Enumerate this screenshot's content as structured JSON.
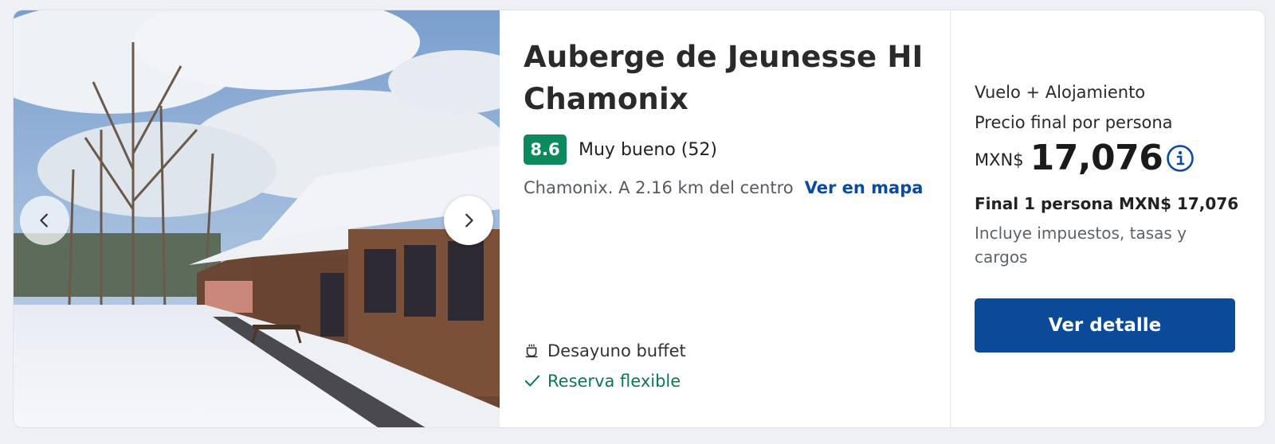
{
  "hotel": {
    "name": "Auberge de Jeunesse HI Chamonix",
    "score": "8.6",
    "rating_label": "Muy bueno (52)",
    "location": "Chamonix. A 2.16 km del centro",
    "map_link": "Ver en mapa",
    "amenities": [
      {
        "label": "Desayuno buffet",
        "icon": "coffee-cup-icon"
      },
      {
        "label": "Reserva flexible",
        "icon": "check-icon"
      }
    ]
  },
  "price": {
    "package_type": "Vuelo + Alojamiento",
    "per_person_label": "Precio final por persona",
    "currency": "MXN$",
    "amount": "17,076",
    "final_line": "Final 1 persona MXN$ 17,076",
    "taxes_note": "Incluye impuestos, tasas y cargos",
    "cta_label": "Ver detalle"
  },
  "colors": {
    "score_badge": "#0b8a5e",
    "link": "#0b4aa3",
    "cta": "#0b4a96",
    "flexible": "#0b7a52"
  },
  "gallery": {
    "prev_icon": "chevron-left-icon",
    "next_icon": "chevron-right-icon"
  }
}
